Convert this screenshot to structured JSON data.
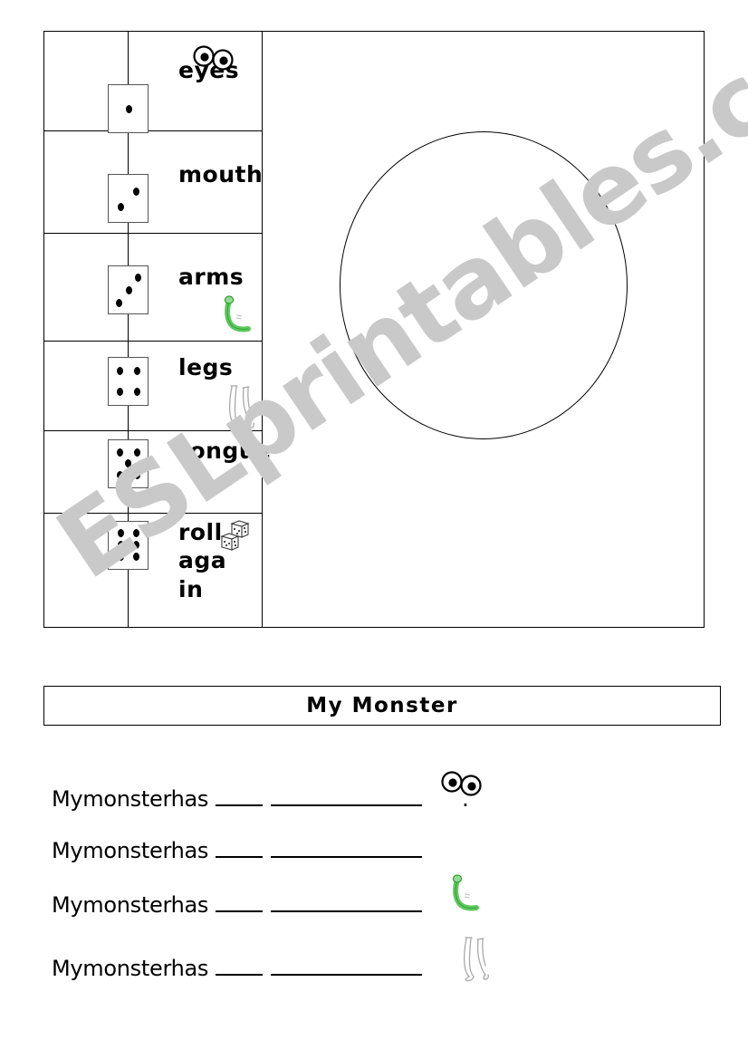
{
  "worksheet": {
    "title": "My Monster",
    "watermark": "ESLprintables.com"
  },
  "dice_table": {
    "rows": [
      {
        "die_value": "1",
        "label": "eyes",
        "icon": "eyes-icon"
      },
      {
        "die_value": "2",
        "label": "mouth",
        "icon": "none"
      },
      {
        "die_value": "3",
        "label": "arms",
        "icon": "green-arm-icon"
      },
      {
        "die_value": "4",
        "label": "legs",
        "icon": "legs-icon"
      },
      {
        "die_value": "5",
        "label": "tongue",
        "icon": "none"
      },
      {
        "die_value": "6",
        "label": "roll\naga\nin",
        "icon": "dice-icon"
      }
    ],
    "drawing_area": "monster-circle"
  },
  "sentences": [
    {
      "text": "Mymonsterhas",
      "icon": "eyes-icon",
      "punctuation": "."
    },
    {
      "text": "Mymonsterhas",
      "icon": "none",
      "punctuation": ""
    },
    {
      "text": "Mymonsterhas",
      "icon": "green-arm-icon",
      "punctuation": ""
    },
    {
      "text": "Mymonsterhas",
      "icon": "legs-icon",
      "punctuation": ""
    }
  ],
  "colors": {
    "ink": "#000000",
    "watermark": "#c9c9c9",
    "arm_green": "#5fc95f",
    "legs_grey": "#9a9a9a",
    "die_border": "#555555"
  }
}
